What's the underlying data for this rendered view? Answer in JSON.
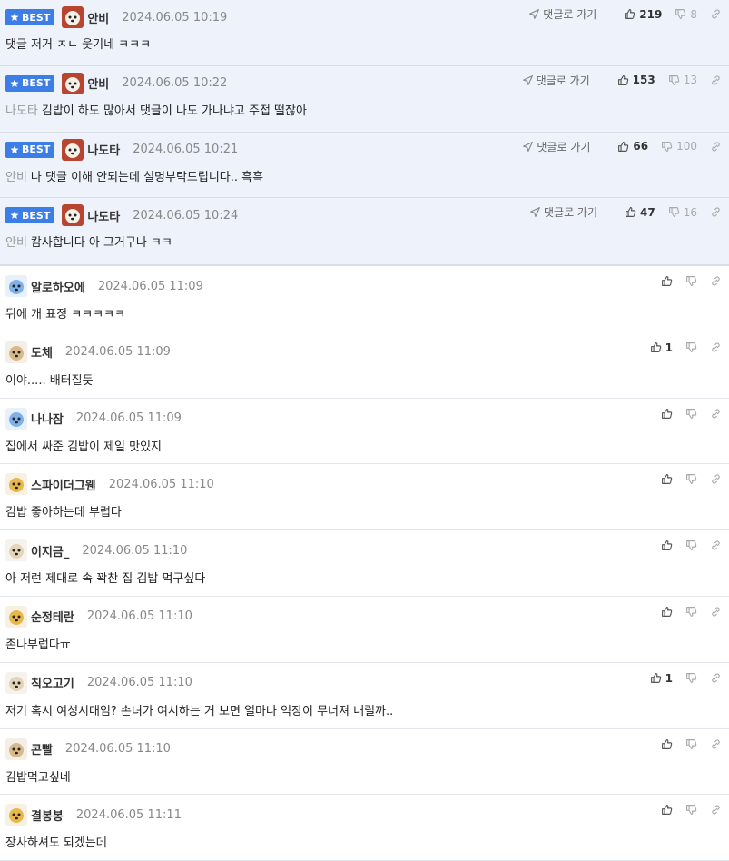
{
  "labels": {
    "best": "BEST",
    "goto": "댓글로 가기"
  },
  "best_comments": [
    {
      "nick": "안비",
      "date": "2024.06.05 10:19",
      "reply_to": "",
      "text": "댓글 저거 ㅈㄴ 웃기네 ㅋㅋㅋ",
      "up": "219",
      "down": "8",
      "avatar": "dog-white"
    },
    {
      "nick": "안비",
      "date": "2024.06.05 10:22",
      "reply_to": "나도타",
      "text": "김밥이 하도 많아서 댓글이 나도 가나냐고 주접 떨잖아",
      "up": "153",
      "down": "13",
      "avatar": "dog-white"
    },
    {
      "nick": "나도타",
      "date": "2024.06.05 10:21",
      "reply_to": "안비",
      "text": "나 댓글 이해 안되는데 설명부탁드립니다.. 흑흑",
      "up": "66",
      "down": "100",
      "avatar": "dog-white"
    },
    {
      "nick": "나도타",
      "date": "2024.06.05 10:24",
      "reply_to": "안비",
      "text": "캄사합니다 아 그거구나 ㅋㅋ",
      "up": "47",
      "down": "16",
      "avatar": "dog-white"
    }
  ],
  "comments": [
    {
      "nick": "알로하오에",
      "date": "2024.06.05 11:09",
      "text": "뒤에 개 표정 ㅋㅋㅋㅋㅋ",
      "up": "",
      "avatar": "blue"
    },
    {
      "nick": "도체",
      "date": "2024.06.05 11:09",
      "text": "이야..... 배터질듯",
      "up": "1",
      "avatar": "puppy"
    },
    {
      "nick": "나나잠",
      "date": "2024.06.05 11:09",
      "text": "집에서 싸준 김밥이 제일 맛있지",
      "up": "",
      "avatar": "blue"
    },
    {
      "nick": "스파이더그웬",
      "date": "2024.06.05 11:10",
      "text": "김밥 좋아하는데 부럽다",
      "up": "",
      "avatar": "fox"
    },
    {
      "nick": "이지금_",
      "date": "2024.06.05 11:10",
      "text": "아 저런 제대로 속 꽉찬 집 김밥 먹구싶다",
      "up": "",
      "avatar": "puppy-light"
    },
    {
      "nick": "순정테란",
      "date": "2024.06.05 11:10",
      "text": "존나부럽다ㅠ",
      "up": "",
      "avatar": "fox"
    },
    {
      "nick": "칙오고기",
      "date": "2024.06.05 11:10",
      "text": "저기 혹시 여성시대임? 손녀가 여시하는 거 보면 얼마나 억장이 무너져 내릴까..",
      "up": "1",
      "avatar": "puppy-light"
    },
    {
      "nick": "콘빨",
      "date": "2024.06.05 11:10",
      "text": "김밥먹고싶네",
      "up": "",
      "avatar": "puppy"
    },
    {
      "nick": "결봉봉",
      "date": "2024.06.05 11:11",
      "text": "장사하셔도 되겠는데",
      "up": "",
      "avatar": "fox"
    }
  ],
  "colors": {
    "best_bg": "#eef2fb",
    "badge": "#3d7ee6"
  }
}
